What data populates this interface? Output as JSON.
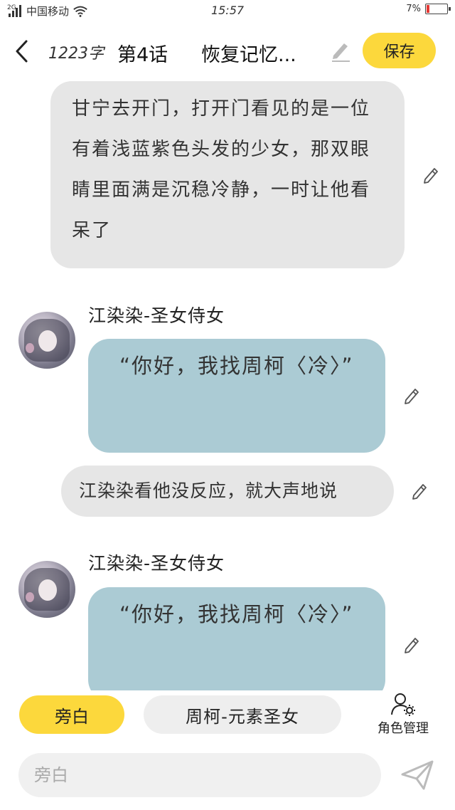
{
  "status_bar": {
    "network": "2G",
    "carrier": "中国移动",
    "time": "15:57",
    "battery": "7%"
  },
  "header": {
    "word_count": "1223字",
    "chapter": "第4话",
    "chapter_title": "恢复记忆...",
    "save_label": "保存"
  },
  "messages": [
    {
      "kind": "narration",
      "text": "甘宁去开门，打开门看见的是一位有着浅蓝紫色头发的少女，那双眼睛里面满是沉稳冷静，一时让他看呆了"
    },
    {
      "kind": "dialogue",
      "character": "江染染-圣女侍女",
      "text": "“你好，我找周柯〈冷〉”"
    },
    {
      "kind": "narration",
      "text": "江染染看他没反应，就大声地说"
    },
    {
      "kind": "dialogue",
      "character": "江染染-圣女侍女",
      "text": "“你好，我找周柯〈冷〉”"
    }
  ],
  "selector": {
    "narration_label": "旁白",
    "character_label": "周柯-元素圣女",
    "role_manage_label": "角色管理"
  },
  "input": {
    "placeholder": "旁白"
  },
  "colors": {
    "accent": "#fcd83c",
    "dialogue_bubble": "#abcbd4",
    "narration_bubble": "#e6e6e6"
  }
}
